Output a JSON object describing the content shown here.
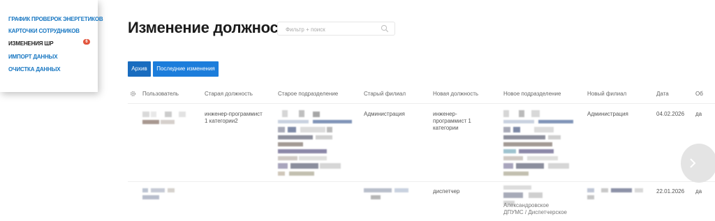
{
  "sidebar": {
    "items": [
      {
        "label": "График проверок энергетиков",
        "active": false
      },
      {
        "label": "Карточки сотрудников",
        "active": false
      },
      {
        "label": "Изменения ШР",
        "active": true
      },
      {
        "label": "Импорт данных",
        "active": false
      },
      {
        "label": "Очистка данных",
        "active": false
      }
    ],
    "badge_count": "6"
  },
  "header": {
    "title": "Изменение должности"
  },
  "search": {
    "placeholder": "Фильтр + поиск",
    "icon": "search-icon"
  },
  "toolbar": {
    "archive_label": "Архив",
    "latest_label": "Последние изменения"
  },
  "table": {
    "settings_icon": "gear-icon",
    "columns": [
      "Пользователь",
      "Старая должность",
      "Старое подразделение",
      "Старый филиал",
      "Новая должность",
      "Новое подразделение",
      "Новый филиал",
      "Дата",
      "Об"
    ],
    "rows": [
      {
        "old_position": [
          "инженер-программист",
          "1 категории2"
        ],
        "old_branch": "Администрация",
        "new_position": [
          "инженер-",
          "программист 1",
          "категории"
        ],
        "new_branch": "Администрация",
        "date": "04.02.2026",
        "last": "да"
      },
      {
        "new_position": [
          "диспетчер"
        ],
        "new_department_partial": [
          "Александровское",
          "ДПУМС / Диспетчерское"
        ],
        "date": "22.01.2026",
        "last": "да"
      }
    ]
  },
  "colors": {
    "accent": "#1c7ddb",
    "nav": "#1877c2",
    "badge": "#e2553d"
  }
}
